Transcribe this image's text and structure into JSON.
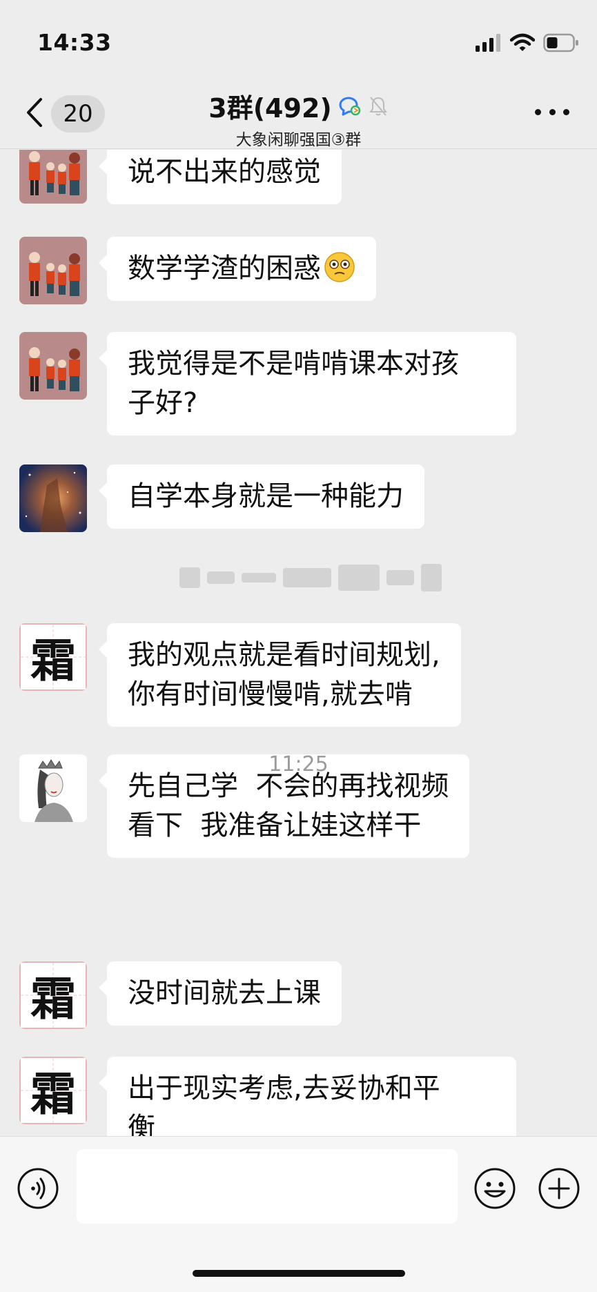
{
  "status_bar": {
    "time": "14:33"
  },
  "nav": {
    "unread_count": "20",
    "title": "3群(492)",
    "subtitle": "大象闲聊强国③群"
  },
  "messages": [
    {
      "avatar": "family-photo",
      "text": "说不出来的感觉"
    },
    {
      "avatar": "family-photo",
      "text": "数学学渣的困惑",
      "emoji": "woozy-face"
    },
    {
      "avatar": "family-photo",
      "text": "我觉得是不是啃啃课本对孩\n子好?"
    },
    {
      "avatar": "galaxy-nebula",
      "text": "自学本身就是一种能力"
    },
    {
      "avatar": "shuang-character",
      "avatar_text": "霜",
      "text": "我的观点就是看时间规划,\n你有时间慢慢啃,就去啃"
    },
    {
      "avatar": "queen-sketch",
      "text": "先自己学  不会的再找视频\n看下  我准备让娃这样干"
    },
    {
      "avatar": "shuang-character",
      "avatar_text": "霜",
      "text": "没时间就去上课"
    },
    {
      "avatar": "shuang-character",
      "avatar_text": "霜",
      "text": "出于现实考虑,去妥协和平\n衡"
    }
  ],
  "timestamp": "11:25",
  "input": {
    "value": "",
    "placeholder": ""
  },
  "colors": {
    "background": "#ededed",
    "bubble": "#ffffff",
    "timestamp": "#9b9b9b",
    "accent_blue": "#2f7cf6"
  }
}
